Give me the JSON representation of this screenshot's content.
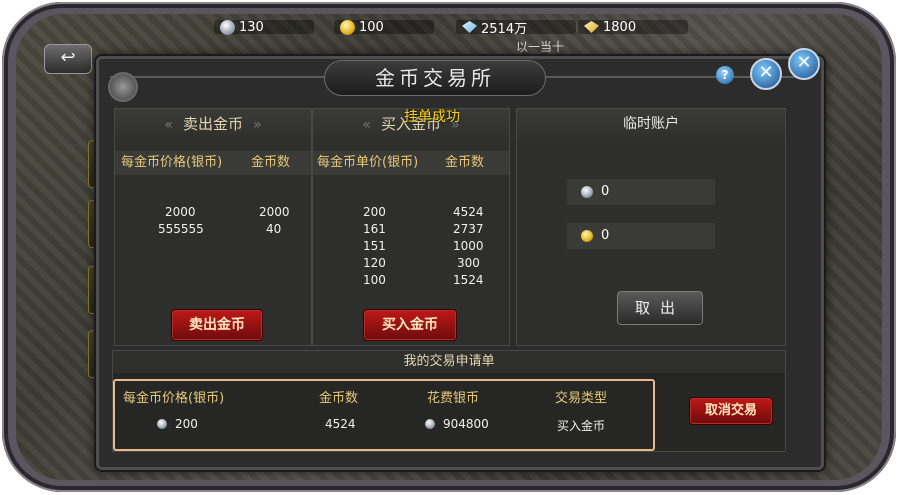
{
  "top_resources": [
    {
      "icon": "silver-coin-icon",
      "value": "130"
    },
    {
      "icon": "gold-coin-icon",
      "value": "100"
    },
    {
      "icon": "diamond-icon",
      "value": "2514万"
    },
    {
      "icon": "gold-bar-icon",
      "value": "1800"
    }
  ],
  "background_text": "以一当十",
  "dialog": {
    "title": "金币交易所",
    "toast": "挂单成功"
  },
  "sell_panel": {
    "title": "卖出金币",
    "col_price": "每金币价格(银币)",
    "col_count": "金币数",
    "rows": [
      {
        "price": "2000",
        "count": "2000"
      },
      {
        "price": "555555",
        "count": "40"
      }
    ],
    "button": "卖出金币"
  },
  "buy_panel": {
    "title": "买入金币",
    "col_price": "每金币单价(银币)",
    "col_count": "金币数",
    "rows": [
      {
        "price": "200",
        "count": "4524"
      },
      {
        "price": "161",
        "count": "2737"
      },
      {
        "price": "151",
        "count": "1000"
      },
      {
        "price": "120",
        "count": "300"
      },
      {
        "price": "100",
        "count": "1524"
      }
    ],
    "button": "买入金币"
  },
  "temp_account": {
    "title": "临时账户",
    "silver": "0",
    "gold": "0",
    "button": "取出"
  },
  "my_orders": {
    "title": "我的交易申请单",
    "headers": {
      "price": "每金币价格(银币)",
      "count": "金币数",
      "cost": "花费银币",
      "type": "交易类型"
    },
    "row": {
      "price": "200",
      "count": "4524",
      "cost": "904800",
      "type": "买入金币"
    },
    "cancel_button": "取消交易"
  }
}
